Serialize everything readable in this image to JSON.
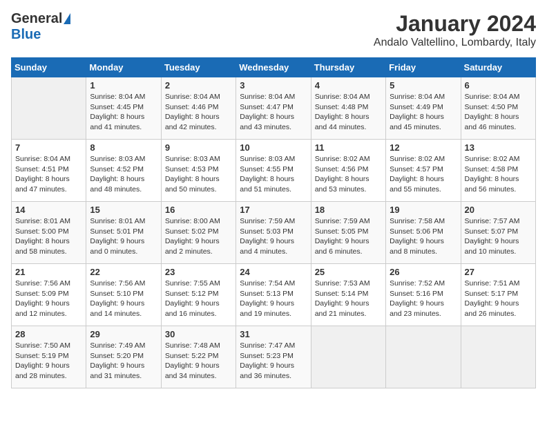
{
  "header": {
    "logo_general": "General",
    "logo_blue": "Blue",
    "month_title": "January 2024",
    "location": "Andalo Valtellino, Lombardy, Italy"
  },
  "weekdays": [
    "Sunday",
    "Monday",
    "Tuesday",
    "Wednesday",
    "Thursday",
    "Friday",
    "Saturday"
  ],
  "weeks": [
    [
      {
        "day": "",
        "empty": true
      },
      {
        "day": "1",
        "sunrise": "Sunrise: 8:04 AM",
        "sunset": "Sunset: 4:45 PM",
        "daylight": "Daylight: 8 hours and 41 minutes."
      },
      {
        "day": "2",
        "sunrise": "Sunrise: 8:04 AM",
        "sunset": "Sunset: 4:46 PM",
        "daylight": "Daylight: 8 hours and 42 minutes."
      },
      {
        "day": "3",
        "sunrise": "Sunrise: 8:04 AM",
        "sunset": "Sunset: 4:47 PM",
        "daylight": "Daylight: 8 hours and 43 minutes."
      },
      {
        "day": "4",
        "sunrise": "Sunrise: 8:04 AM",
        "sunset": "Sunset: 4:48 PM",
        "daylight": "Daylight: 8 hours and 44 minutes."
      },
      {
        "day": "5",
        "sunrise": "Sunrise: 8:04 AM",
        "sunset": "Sunset: 4:49 PM",
        "daylight": "Daylight: 8 hours and 45 minutes."
      },
      {
        "day": "6",
        "sunrise": "Sunrise: 8:04 AM",
        "sunset": "Sunset: 4:50 PM",
        "daylight": "Daylight: 8 hours and 46 minutes."
      }
    ],
    [
      {
        "day": "7",
        "sunrise": "Sunrise: 8:04 AM",
        "sunset": "Sunset: 4:51 PM",
        "daylight": "Daylight: 8 hours and 47 minutes."
      },
      {
        "day": "8",
        "sunrise": "Sunrise: 8:03 AM",
        "sunset": "Sunset: 4:52 PM",
        "daylight": "Daylight: 8 hours and 48 minutes."
      },
      {
        "day": "9",
        "sunrise": "Sunrise: 8:03 AM",
        "sunset": "Sunset: 4:53 PM",
        "daylight": "Daylight: 8 hours and 50 minutes."
      },
      {
        "day": "10",
        "sunrise": "Sunrise: 8:03 AM",
        "sunset": "Sunset: 4:55 PM",
        "daylight": "Daylight: 8 hours and 51 minutes."
      },
      {
        "day": "11",
        "sunrise": "Sunrise: 8:02 AM",
        "sunset": "Sunset: 4:56 PM",
        "daylight": "Daylight: 8 hours and 53 minutes."
      },
      {
        "day": "12",
        "sunrise": "Sunrise: 8:02 AM",
        "sunset": "Sunset: 4:57 PM",
        "daylight": "Daylight: 8 hours and 55 minutes."
      },
      {
        "day": "13",
        "sunrise": "Sunrise: 8:02 AM",
        "sunset": "Sunset: 4:58 PM",
        "daylight": "Daylight: 8 hours and 56 minutes."
      }
    ],
    [
      {
        "day": "14",
        "sunrise": "Sunrise: 8:01 AM",
        "sunset": "Sunset: 5:00 PM",
        "daylight": "Daylight: 8 hours and 58 minutes."
      },
      {
        "day": "15",
        "sunrise": "Sunrise: 8:01 AM",
        "sunset": "Sunset: 5:01 PM",
        "daylight": "Daylight: 9 hours and 0 minutes."
      },
      {
        "day": "16",
        "sunrise": "Sunrise: 8:00 AM",
        "sunset": "Sunset: 5:02 PM",
        "daylight": "Daylight: 9 hours and 2 minutes."
      },
      {
        "day": "17",
        "sunrise": "Sunrise: 7:59 AM",
        "sunset": "Sunset: 5:03 PM",
        "daylight": "Daylight: 9 hours and 4 minutes."
      },
      {
        "day": "18",
        "sunrise": "Sunrise: 7:59 AM",
        "sunset": "Sunset: 5:05 PM",
        "daylight": "Daylight: 9 hours and 6 minutes."
      },
      {
        "day": "19",
        "sunrise": "Sunrise: 7:58 AM",
        "sunset": "Sunset: 5:06 PM",
        "daylight": "Daylight: 9 hours and 8 minutes."
      },
      {
        "day": "20",
        "sunrise": "Sunrise: 7:57 AM",
        "sunset": "Sunset: 5:07 PM",
        "daylight": "Daylight: 9 hours and 10 minutes."
      }
    ],
    [
      {
        "day": "21",
        "sunrise": "Sunrise: 7:56 AM",
        "sunset": "Sunset: 5:09 PM",
        "daylight": "Daylight: 9 hours and 12 minutes."
      },
      {
        "day": "22",
        "sunrise": "Sunrise: 7:56 AM",
        "sunset": "Sunset: 5:10 PM",
        "daylight": "Daylight: 9 hours and 14 minutes."
      },
      {
        "day": "23",
        "sunrise": "Sunrise: 7:55 AM",
        "sunset": "Sunset: 5:12 PM",
        "daylight": "Daylight: 9 hours and 16 minutes."
      },
      {
        "day": "24",
        "sunrise": "Sunrise: 7:54 AM",
        "sunset": "Sunset: 5:13 PM",
        "daylight": "Daylight: 9 hours and 19 minutes."
      },
      {
        "day": "25",
        "sunrise": "Sunrise: 7:53 AM",
        "sunset": "Sunset: 5:14 PM",
        "daylight": "Daylight: 9 hours and 21 minutes."
      },
      {
        "day": "26",
        "sunrise": "Sunrise: 7:52 AM",
        "sunset": "Sunset: 5:16 PM",
        "daylight": "Daylight: 9 hours and 23 minutes."
      },
      {
        "day": "27",
        "sunrise": "Sunrise: 7:51 AM",
        "sunset": "Sunset: 5:17 PM",
        "daylight": "Daylight: 9 hours and 26 minutes."
      }
    ],
    [
      {
        "day": "28",
        "sunrise": "Sunrise: 7:50 AM",
        "sunset": "Sunset: 5:19 PM",
        "daylight": "Daylight: 9 hours and 28 minutes."
      },
      {
        "day": "29",
        "sunrise": "Sunrise: 7:49 AM",
        "sunset": "Sunset: 5:20 PM",
        "daylight": "Daylight: 9 hours and 31 minutes."
      },
      {
        "day": "30",
        "sunrise": "Sunrise: 7:48 AM",
        "sunset": "Sunset: 5:22 PM",
        "daylight": "Daylight: 9 hours and 34 minutes."
      },
      {
        "day": "31",
        "sunrise": "Sunrise: 7:47 AM",
        "sunset": "Sunset: 5:23 PM",
        "daylight": "Daylight: 9 hours and 36 minutes."
      },
      {
        "day": "",
        "empty": true
      },
      {
        "day": "",
        "empty": true
      },
      {
        "day": "",
        "empty": true
      }
    ]
  ]
}
